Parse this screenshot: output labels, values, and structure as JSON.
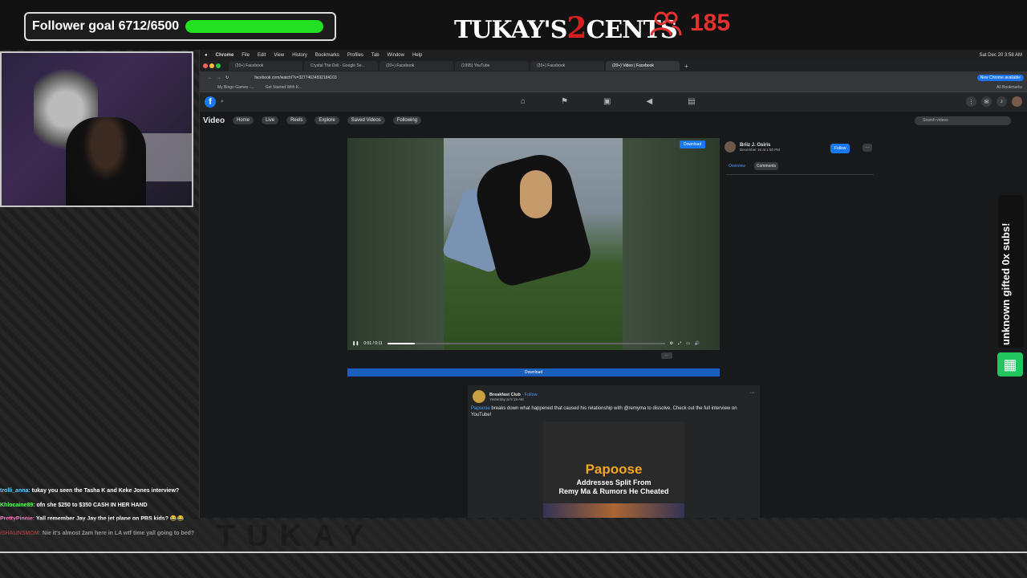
{
  "overlay": {
    "follower_goal_label": "Follower goal 6712/6500",
    "follower_goal_progress": 1.0,
    "logo_left": "TUKAY'S",
    "logo_num": "2",
    "logo_right": "CENTS",
    "viewer_count": "185",
    "sub_alert": "unknown gifted 0x subs!",
    "accent_green": "#22e022",
    "accent_red": "#e53030"
  },
  "chat": [
    {
      "user": "trolli_anna:",
      "msg": " tukay you seen the Tasha K and Keke Jones interview?",
      "color": "#5fd3ff"
    },
    {
      "user": "Khlocaine89:",
      "msg": " ofn she $250 to $350 CASH IN HER HAND",
      "color": "#5fff5f"
    },
    {
      "user": "PrettyPinnie:",
      "msg": " Yall remember Jay Jay the jet plane on PBS kids? 😂😂",
      "color": "#ff79c6"
    },
    {
      "user": "iSHAUNSMOM:",
      "msg": " Nie it's almost 2am here in LA wtf time yall going to bed?",
      "color": "#ff5555"
    }
  ],
  "mac_menu": [
    "Chrome",
    "File",
    "Edit",
    "View",
    "History",
    "Bookmarks",
    "Profiles",
    "Tab",
    "Window",
    "Help"
  ],
  "mac_clock": "Sat Dec 20 3:58 AM",
  "browser_tabs": [
    {
      "label": "(20+) Facebook"
    },
    {
      "label": "Crystal The Doll - Google Se..."
    },
    {
      "label": "(20+) Facebook"
    },
    {
      "label": "(1995) YouTube"
    },
    {
      "label": "(20+) Facebook"
    },
    {
      "label": "(20+) Video | Facebook",
      "active": true
    }
  ],
  "address": {
    "url": "facebook.com/watch/?v=327746345921841​03",
    "new_chrome": "New Chrome available"
  },
  "bookmarks": [
    "My Bingo Games -...",
    "Get Started With K..."
  ],
  "all_bookmarks": "All Bookmarks",
  "fb_video_nav": {
    "title": "Video",
    "items": [
      "Home",
      "Live",
      "Reels",
      "Explore",
      "Saved Videos",
      "Following"
    ],
    "search_placeholder": "Search videos"
  },
  "player": {
    "time": "0:01 / 0:11",
    "progress": 0.1,
    "download_badge": "Download",
    "download_bar": "Download"
  },
  "author": {
    "name": "Briiz J. Osiris",
    "date": "December 16 at 1:50 PM",
    "follow": "Follow",
    "tab_overview": "Overview",
    "tab_comments": "Comments"
  },
  "post": {
    "name": "Breakfast Club",
    "follow": "· Follow",
    "time": "Yesterday at 9:19 AM",
    "tag": "Papoose",
    "text": " breaks down what happened that caused his relationship with @remyma to dissolve. Check out the full interview on YouTube!",
    "img_title": "Papoose",
    "img_subtitle_1": "Addresses Split From",
    "img_subtitle_2": "Remy Ma & Rumors He Cheated"
  }
}
